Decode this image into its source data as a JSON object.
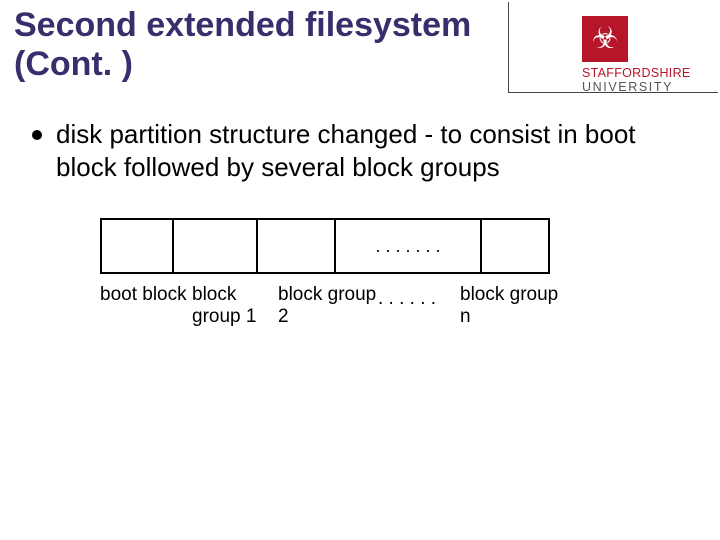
{
  "title": "Second extended filesystem (Cont. )",
  "logo": {
    "line1": "STAFFORDSHIRE",
    "line2": "UNIVERSITY",
    "glyph": "☣"
  },
  "bullet": "disk partition structure changed - to consist in boot block followed by several block groups",
  "strip_ellipsis": ". . . . . . .",
  "labels": {
    "boot": "boot block",
    "g1": "block group 1",
    "g2": "block group 2",
    "dots": ". . . . . .",
    "gn": "block group n"
  }
}
